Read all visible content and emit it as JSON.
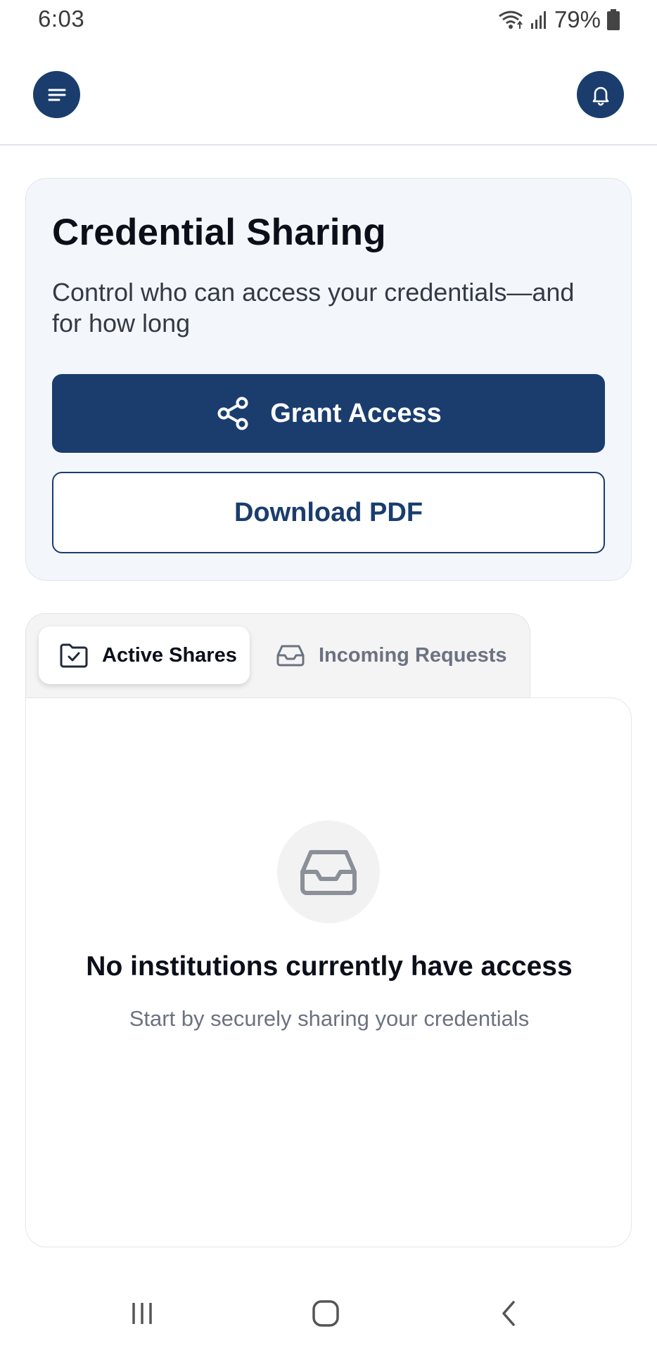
{
  "status_bar": {
    "time": "6:03",
    "battery": "79%",
    "icons": [
      "wifi-icon",
      "signal-icon",
      "battery-icon"
    ]
  },
  "header": {
    "menu_icon": "menu-icon",
    "notification_icon": "bell-icon"
  },
  "hero": {
    "title": "Credential Sharing",
    "subtitle": "Control who can access your credentials—and for how long",
    "grant_button": {
      "label": "Grant Access",
      "icon": "share-icon"
    },
    "download_button": {
      "label": "Download PDF"
    }
  },
  "tabs": [
    {
      "label": "Active Shares",
      "icon": "folder-check-icon",
      "active": true
    },
    {
      "label": "Incoming Requests",
      "icon": "inbox-icon",
      "active": false
    }
  ],
  "empty_state": {
    "icon": "inbox-icon",
    "title": "No institutions currently have access",
    "subtitle": "Start by securely sharing your credentials"
  },
  "nav": {
    "items": [
      "recent-apps-icon",
      "home-icon",
      "back-icon"
    ]
  },
  "colors": {
    "primary": "#1a3d6e",
    "hero_bg": "#f3f7fb",
    "muted_text": "#6b7280"
  }
}
